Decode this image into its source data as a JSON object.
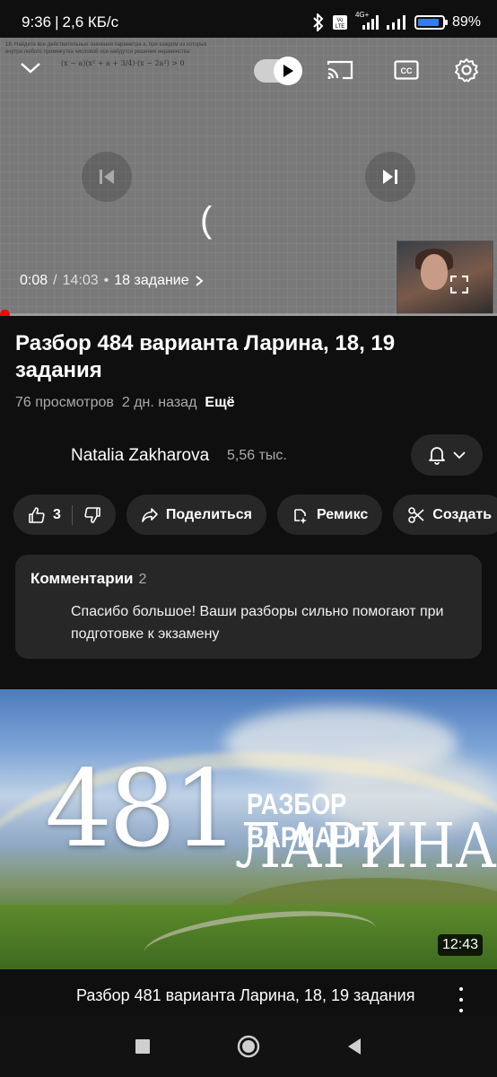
{
  "status_bar": {
    "time": "9:36",
    "speed": "2,6 КБ/с",
    "network": "4G+",
    "battery": "89%",
    "battery_level": 0.89
  },
  "player": {
    "task_text": "18. Найдите все действительные значения параметра a, при каждом из которых внутри любого промежутка числовой оси найдутся решения неравенства",
    "formula": "(x − a)(x² + a + 3/4)·(x − 2a²) > 0",
    "current_time": "0:08",
    "duration": "14:03",
    "chapter": "18 задание",
    "progress": 0.009
  },
  "video": {
    "title": "Разбор 484 варианта Ларина, 18, 19 задания",
    "views": "76 просмотров",
    "age": "2 дн. назад",
    "more": "Ещё"
  },
  "channel": {
    "name": "Natalia Zakharova",
    "subscribers": "5,56 тыс."
  },
  "actions": {
    "likes": "3",
    "share": "Поделиться",
    "remix": "Ремикс",
    "create": "Создать"
  },
  "comments": {
    "header": "Комментарии",
    "count": "2",
    "top_comment": "Спасибо большое! Ваши разборы сильно помогают при подготовке к экзамену"
  },
  "next_video": {
    "thumb_number": "481",
    "thumb_line1": "РАЗБОР ВАРИАНТА",
    "thumb_line2": "ЛАРИНА",
    "duration": "12:43",
    "title": "Разбор 481 варианта Ларина, 18, 19 задания"
  },
  "colors": {
    "accent_red": "#ff0000",
    "battery_blue": "#2f7ef6",
    "chip_bg": "#272727",
    "page_bg": "#0f0f0f"
  }
}
